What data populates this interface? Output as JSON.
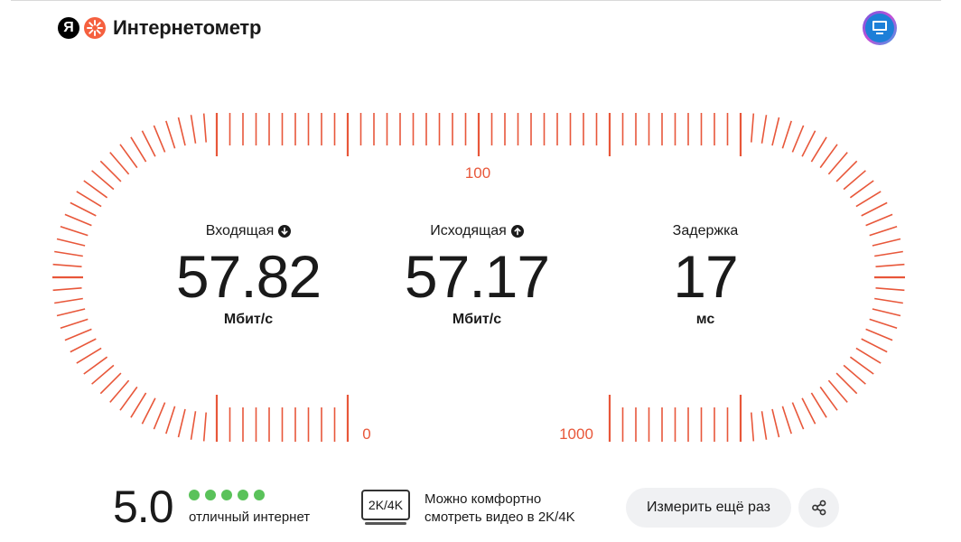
{
  "header": {
    "ya_letter": "Я",
    "title": "Интернетометр"
  },
  "gauge": {
    "labels": {
      "top": "100",
      "bottom_left": "0",
      "bottom_right": "1000"
    },
    "tick_color": "#e8573a"
  },
  "metrics": {
    "download": {
      "label": "Входящая",
      "value": "57.82",
      "unit": "Мбит/с",
      "icon": "arrow-down-icon"
    },
    "upload": {
      "label": "Исходящая",
      "value": "57.17",
      "unit": "Мбит/с",
      "icon": "arrow-up-icon"
    },
    "latency": {
      "label": "Задержка",
      "value": "17",
      "unit": "мс"
    }
  },
  "rating": {
    "value": "5.0",
    "dots_filled": 5,
    "dots_total": 5,
    "dot_color": "#5ac25a",
    "text": "отличный интернет"
  },
  "video": {
    "badge": "2K/4K",
    "line1": "Можно комфортно",
    "line2": "смотреть видео в 2K/4K"
  },
  "actions": {
    "retry_label": "Измерить ещё раз",
    "share_icon": "share-icon"
  }
}
